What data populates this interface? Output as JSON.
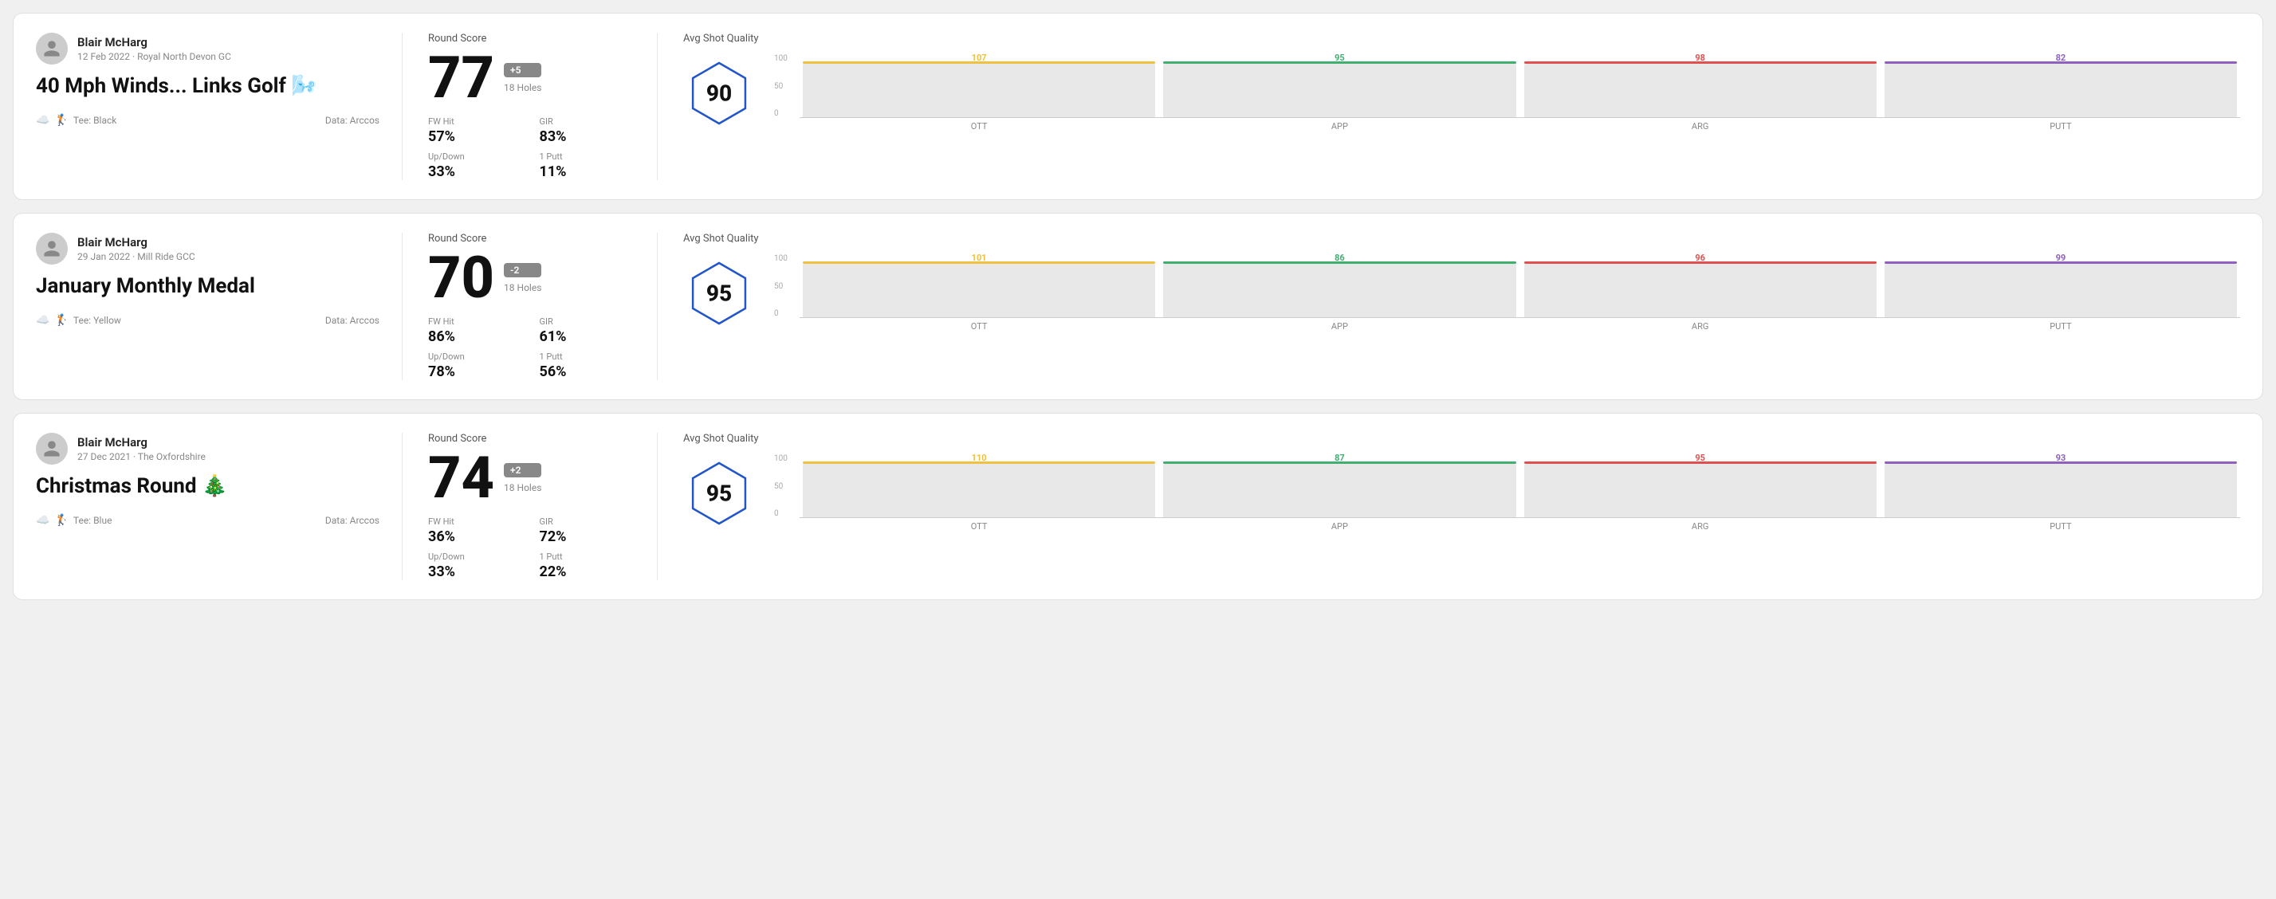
{
  "rounds": [
    {
      "id": "round1",
      "user": {
        "name": "Blair McHarg",
        "date_course": "12 Feb 2022 · Royal North Devon GC"
      },
      "title": "40 Mph Winds... Links Golf 🌬️",
      "tee": "Black",
      "data_source": "Data: Arccos",
      "round_score_label": "Round Score",
      "score": "77",
      "score_diff": "+5",
      "score_diff_type": "positive",
      "holes": "18 Holes",
      "fw_hit_label": "FW Hit",
      "fw_hit_value": "57%",
      "gir_label": "GIR",
      "gir_value": "83%",
      "updown_label": "Up/Down",
      "updown_value": "33%",
      "oneputt_label": "1 Putt",
      "oneputt_value": "11%",
      "avg_shot_quality_label": "Avg Shot Quality",
      "hex_score": "90",
      "chart": {
        "y_labels": [
          "100",
          "50",
          "0"
        ],
        "columns": [
          {
            "label": "OTT",
            "value": 107,
            "color": "#f0c040"
          },
          {
            "label": "APP",
            "value": 95,
            "color": "#40b070"
          },
          {
            "label": "ARG",
            "value": 98,
            "color": "#e05050"
          },
          {
            "label": "PUTT",
            "value": 82,
            "color": "#9060c0"
          }
        ]
      }
    },
    {
      "id": "round2",
      "user": {
        "name": "Blair McHarg",
        "date_course": "29 Jan 2022 · Mill Ride GCC"
      },
      "title": "January Monthly Medal",
      "tee": "Yellow",
      "data_source": "Data: Arccos",
      "round_score_label": "Round Score",
      "score": "70",
      "score_diff": "-2",
      "score_diff_type": "negative",
      "holes": "18 Holes",
      "fw_hit_label": "FW Hit",
      "fw_hit_value": "86%",
      "gir_label": "GIR",
      "gir_value": "61%",
      "updown_label": "Up/Down",
      "updown_value": "78%",
      "oneputt_label": "1 Putt",
      "oneputt_value": "56%",
      "avg_shot_quality_label": "Avg Shot Quality",
      "hex_score": "95",
      "chart": {
        "y_labels": [
          "100",
          "50",
          "0"
        ],
        "columns": [
          {
            "label": "OTT",
            "value": 101,
            "color": "#f0c040"
          },
          {
            "label": "APP",
            "value": 86,
            "color": "#40b070"
          },
          {
            "label": "ARG",
            "value": 96,
            "color": "#e05050"
          },
          {
            "label": "PUTT",
            "value": 99,
            "color": "#9060c0"
          }
        ]
      }
    },
    {
      "id": "round3",
      "user": {
        "name": "Blair McHarg",
        "date_course": "27 Dec 2021 · The Oxfordshire"
      },
      "title": "Christmas Round 🎄",
      "tee": "Blue",
      "data_source": "Data: Arccos",
      "round_score_label": "Round Score",
      "score": "74",
      "score_diff": "+2",
      "score_diff_type": "positive",
      "holes": "18 Holes",
      "fw_hit_label": "FW Hit",
      "fw_hit_value": "36%",
      "gir_label": "GIR",
      "gir_value": "72%",
      "updown_label": "Up/Down",
      "updown_value": "33%",
      "oneputt_label": "1 Putt",
      "oneputt_value": "22%",
      "avg_shot_quality_label": "Avg Shot Quality",
      "hex_score": "95",
      "chart": {
        "y_labels": [
          "100",
          "50",
          "0"
        ],
        "columns": [
          {
            "label": "OTT",
            "value": 110,
            "color": "#f0c040"
          },
          {
            "label": "APP",
            "value": 87,
            "color": "#40b070"
          },
          {
            "label": "ARG",
            "value": 95,
            "color": "#e05050"
          },
          {
            "label": "PUTT",
            "value": 93,
            "color": "#9060c0"
          }
        ]
      }
    }
  ]
}
